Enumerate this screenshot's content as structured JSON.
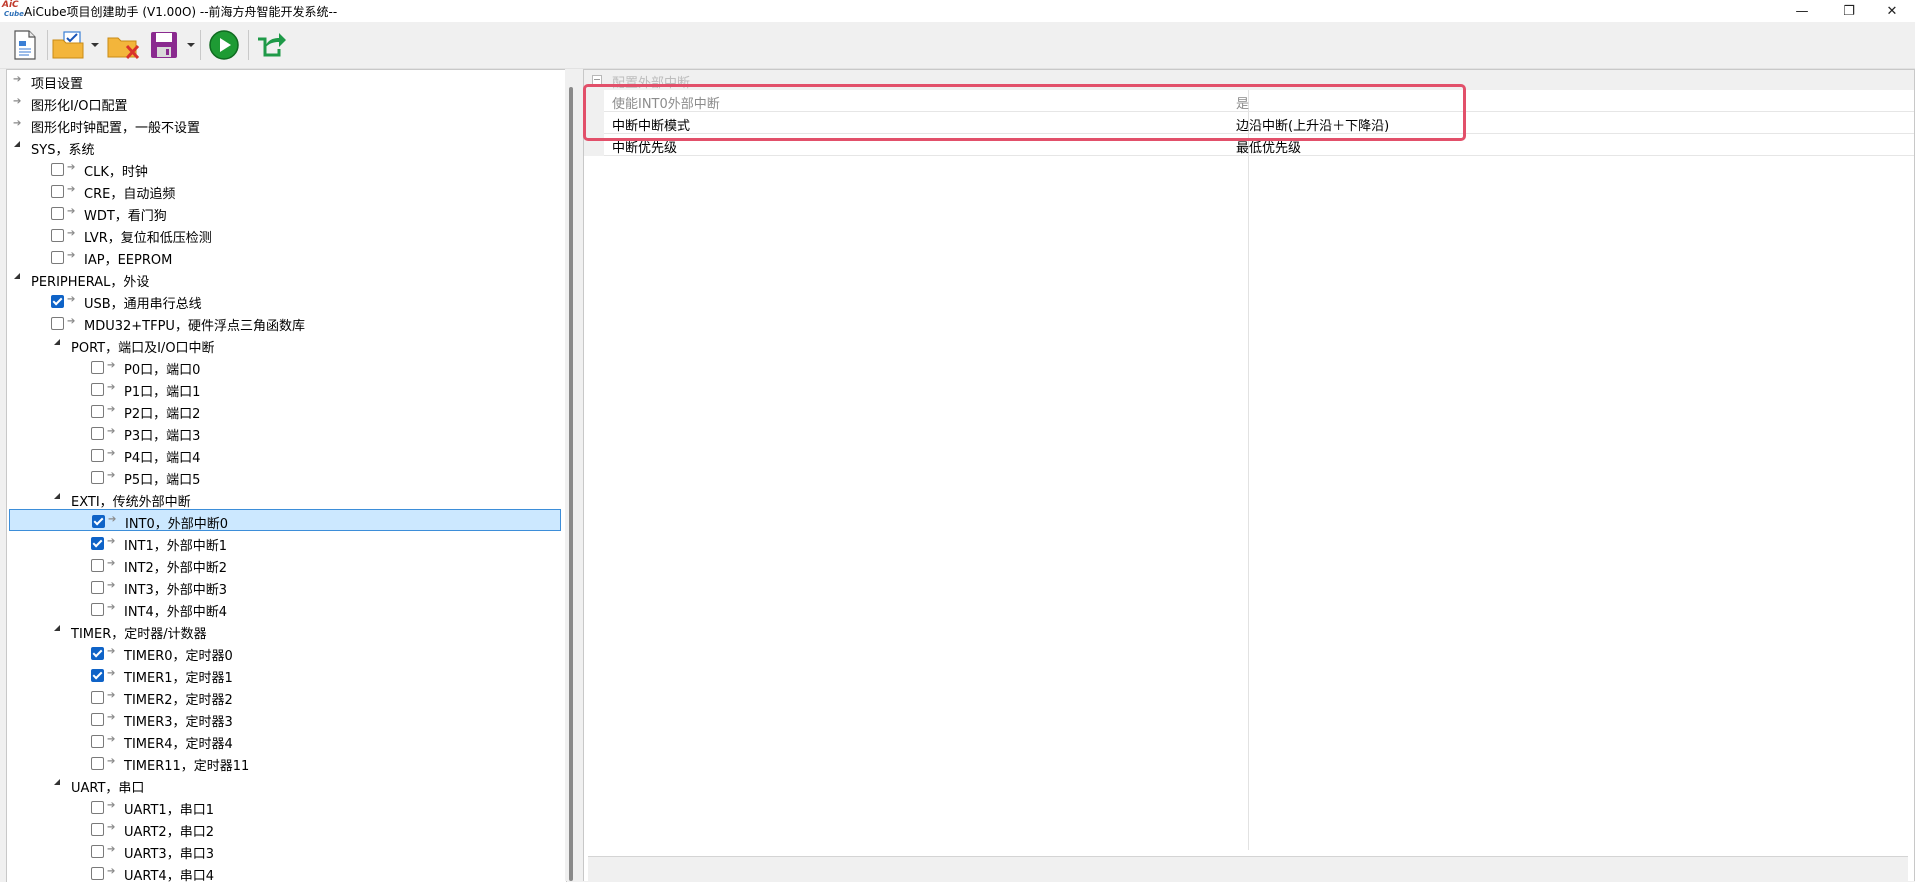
{
  "window": {
    "title": "AiCube项目创建助手 (V1.00O) --前海方舟智能开发系统--",
    "logo_top": "AiC",
    "logo_bottom": "Cube",
    "minimize": "—",
    "maximize": "❐",
    "close": "✕"
  },
  "toolbar": {
    "buttons": [
      {
        "name": "new-project",
        "icon": "new-document-icon"
      },
      {
        "name": "open-project",
        "icon": "open-folder-icon",
        "dropdown": true
      },
      {
        "name": "close-project",
        "icon": "folder-close-icon"
      },
      {
        "name": "save-project",
        "icon": "save-icon",
        "dropdown": true
      },
      {
        "name": "run",
        "icon": "play-icon"
      },
      {
        "name": "export",
        "icon": "export-icon"
      }
    ],
    "colors": {
      "run": "#1e9b34",
      "export": "#1f9a48",
      "save": "#8a2a8f"
    }
  },
  "tree": {
    "items": [
      {
        "text": "项目设置",
        "level": 0,
        "kind": "leaf"
      },
      {
        "text": "图形化I/O口配置",
        "level": 0,
        "kind": "leaf"
      },
      {
        "text": "图形化时钟配置，一般不设置",
        "level": 0,
        "kind": "leaf"
      },
      {
        "text": "SYS，系统",
        "level": 0,
        "kind": "group"
      },
      {
        "text": "CLK，时钟",
        "level": 1,
        "kind": "check",
        "checked": false
      },
      {
        "text": "CRE，自动追频",
        "level": 1,
        "kind": "check",
        "checked": false
      },
      {
        "text": "WDT，看门狗",
        "level": 1,
        "kind": "check",
        "checked": false
      },
      {
        "text": "LVR，复位和低压检测",
        "level": 1,
        "kind": "check",
        "checked": false
      },
      {
        "text": "IAP，EEPROM",
        "level": 1,
        "kind": "check",
        "checked": false
      },
      {
        "text": "PERIPHERAL，外设",
        "level": 0,
        "kind": "group"
      },
      {
        "text": "USB，通用串行总线",
        "level": 1,
        "kind": "check",
        "checked": true
      },
      {
        "text": "MDU32+TFPU，硬件浮点三角函数库",
        "level": 1,
        "kind": "check",
        "checked": false
      },
      {
        "text": "PORT，端口及I/O口中断",
        "level": 1,
        "kind": "group"
      },
      {
        "text": "P0口，端口0",
        "level": 2,
        "kind": "check",
        "checked": false
      },
      {
        "text": "P1口，端口1",
        "level": 2,
        "kind": "check",
        "checked": false
      },
      {
        "text": "P2口，端口2",
        "level": 2,
        "kind": "check",
        "checked": false
      },
      {
        "text": "P3口，端口3",
        "level": 2,
        "kind": "check",
        "checked": false
      },
      {
        "text": "P4口，端口4",
        "level": 2,
        "kind": "check",
        "checked": false
      },
      {
        "text": "P5口，端口5",
        "level": 2,
        "kind": "check",
        "checked": false
      },
      {
        "text": "EXTI，传统外部中断",
        "level": 1,
        "kind": "group"
      },
      {
        "text": "INT0，外部中断0",
        "level": 2,
        "kind": "check",
        "checked": true,
        "selected": true
      },
      {
        "text": "INT1，外部中断1",
        "level": 2,
        "kind": "check",
        "checked": true
      },
      {
        "text": "INT2，外部中断2",
        "level": 2,
        "kind": "check",
        "checked": false
      },
      {
        "text": "INT3，外部中断3",
        "level": 2,
        "kind": "check",
        "checked": false
      },
      {
        "text": "INT4，外部中断4",
        "level": 2,
        "kind": "check",
        "checked": false
      },
      {
        "text": "TIMER，定时器/计数器",
        "level": 1,
        "kind": "group"
      },
      {
        "text": "TIMER0，定时器0",
        "level": 2,
        "kind": "check",
        "checked": true
      },
      {
        "text": "TIMER1，定时器1",
        "level": 2,
        "kind": "check",
        "checked": true
      },
      {
        "text": "TIMER2，定时器2",
        "level": 2,
        "kind": "check",
        "checked": false
      },
      {
        "text": "TIMER3，定时器3",
        "level": 2,
        "kind": "check",
        "checked": false
      },
      {
        "text": "TIMER4，定时器4",
        "level": 2,
        "kind": "check",
        "checked": false
      },
      {
        "text": "TIMER11，定时器11",
        "level": 2,
        "kind": "check",
        "checked": false
      },
      {
        "text": "UART，串口",
        "level": 1,
        "kind": "group"
      },
      {
        "text": "UART1，串口1",
        "level": 2,
        "kind": "check",
        "checked": false
      },
      {
        "text": "UART2，串口2",
        "level": 2,
        "kind": "check",
        "checked": false
      },
      {
        "text": "UART3，串口3",
        "level": 2,
        "kind": "check",
        "checked": false
      },
      {
        "text": "UART4，串口4",
        "level": 2,
        "kind": "check",
        "checked": false
      }
    ]
  },
  "properties": {
    "category": "配置外部中断",
    "rows": [
      {
        "name": "使能INT0外部中断",
        "value": "是",
        "disabled": true
      },
      {
        "name": "中断中断模式",
        "value": "边沿中断(上升沿＋下降沿)"
      },
      {
        "name": "中断优先级",
        "value": "最低优先级"
      }
    ],
    "highlight_color": "#e2506a"
  }
}
